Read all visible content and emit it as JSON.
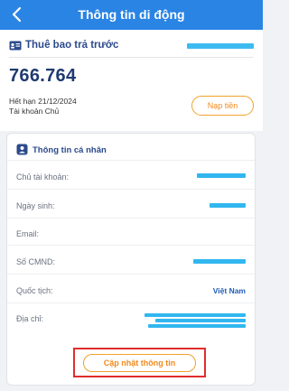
{
  "header": {
    "title": "Thông tin di động"
  },
  "subscription": {
    "type_label": "Thuê bao trả trước",
    "balance": "766.764",
    "expiry": "Hết hạn 21/12/2024",
    "account_type": "Tài khoản Chủ",
    "topup_label": "Nạp tiền"
  },
  "personal_info": {
    "title": "Thông tin cá nhân",
    "rows": [
      {
        "label": "Chủ tài khoản:",
        "value": ""
      },
      {
        "label": "Ngày sinh:",
        "value": ""
      },
      {
        "label": "Email:",
        "value": ""
      },
      {
        "label": "Số CMND:",
        "value": ""
      },
      {
        "label": "Quốc tịch:",
        "value": "Việt Nam"
      },
      {
        "label": "Địa chỉ:",
        "value": ""
      }
    ],
    "update_label": "Cập nhật thông tin"
  },
  "colors": {
    "primary": "#2a84e4",
    "accent": "#f28a1d",
    "highlight": "#e12d2d"
  }
}
